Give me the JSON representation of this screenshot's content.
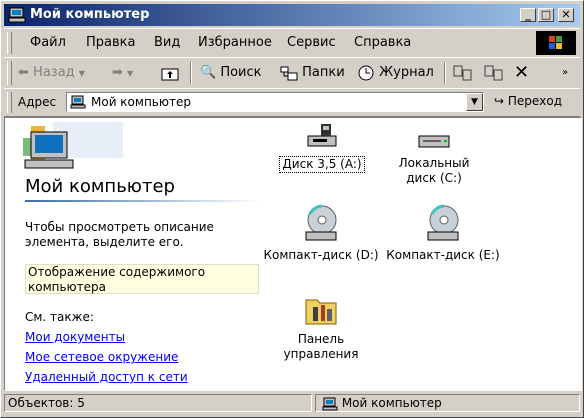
{
  "window": {
    "title": "Мой компьютер",
    "controls": {
      "minimize": "_",
      "maximize": "□",
      "close": "✕"
    }
  },
  "menu": {
    "items": [
      "Файл",
      "Правка",
      "Вид",
      "Избранное",
      "Сервис",
      "Справка"
    ]
  },
  "toolbar": {
    "back": "Назад",
    "search": "Поиск",
    "folders": "Папки",
    "history": "Журнал"
  },
  "address": {
    "label": "Адрес",
    "value": "Мой компьютер",
    "go": "Переход"
  },
  "panel": {
    "title": "Мой компьютер",
    "description": "Чтобы просмотреть описание элемента, выделите его.",
    "hint": "Отображение содержимого компьютера",
    "see_also": "См. также:",
    "links": [
      "Мои документы",
      "Мое сетевое окружение",
      "Удаленный доступ к сети"
    ]
  },
  "items": [
    {
      "label": "Диск 3,5 (A:)",
      "icon": "floppy-drive-icon"
    },
    {
      "label": "Локальный диск (C:)",
      "icon": "hard-drive-icon"
    },
    {
      "label": "Компакт-диск (D:)",
      "icon": "cd-drive-icon"
    },
    {
      "label": "Компакт-диск (E:)",
      "icon": "cd-drive-icon"
    },
    {
      "label": "Панель управления",
      "icon": "control-panel-icon"
    }
  ],
  "status": {
    "objects": "Объектов: 5",
    "location": "Мой компьютер"
  }
}
